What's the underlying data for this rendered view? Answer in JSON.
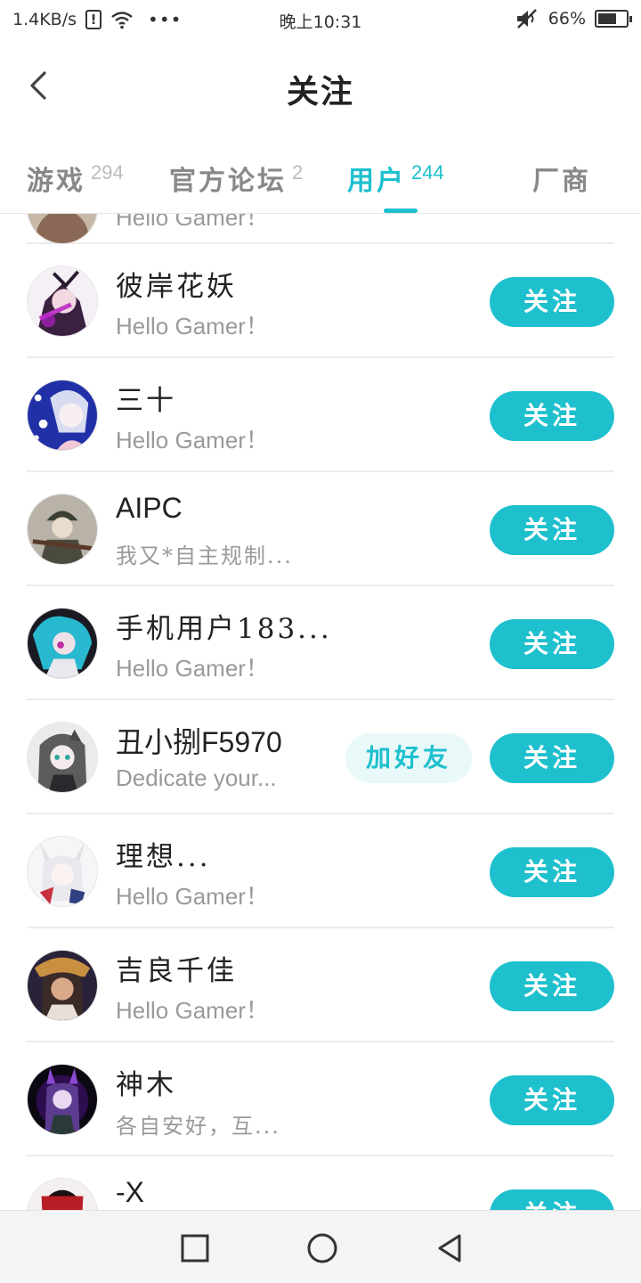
{
  "status_bar": {
    "net_speed": "1.4KB/s",
    "warn_icon": "!",
    "dots": "•••",
    "time": "晚上10:31",
    "battery": "66%",
    "battery_level": 0.66
  },
  "header": {
    "title": "关注",
    "back_icon": "chevron-left-icon"
  },
  "tabs": [
    {
      "label": "游戏",
      "count": "294"
    },
    {
      "label": "官方论坛",
      "count": "2"
    },
    {
      "label": "用户",
      "count": "244"
    },
    {
      "label": "厂商",
      "count": ""
    }
  ],
  "active_tab": "用户",
  "accent_color": "#1ec0cd",
  "users": [
    {
      "name": "",
      "bio": "Hello Gamer！"
    },
    {
      "name": "彼岸花妖",
      "bio": "Hello Gamer！",
      "follow": "关注"
    },
    {
      "name": "三十",
      "bio": "Hello Gamer！",
      "follow": "关注"
    },
    {
      "name": "AIPC",
      "bio": "我又*自主规制...",
      "follow": "关注"
    },
    {
      "name": "手机用户183...",
      "bio": "Hello Gamer！",
      "follow": "关注"
    },
    {
      "name": "丑小捌F5970",
      "bio": "Dedicate your...",
      "follow": "关注",
      "add_friend": "加好友"
    },
    {
      "name": "理想...",
      "bio": "Hello Gamer！",
      "follow": "关注"
    },
    {
      "name": "吉良千佳",
      "bio": "Hello Gamer！",
      "follow": "关注"
    },
    {
      "name": "神木",
      "bio": "各自安好，互...",
      "follow": "关注"
    },
    {
      "name": "-X",
      "bio": "",
      "follow": "关注"
    }
  ],
  "nav": {
    "recent_icon": "square-icon",
    "home_icon": "circle-icon",
    "back_icon": "triangle-back-icon"
  }
}
